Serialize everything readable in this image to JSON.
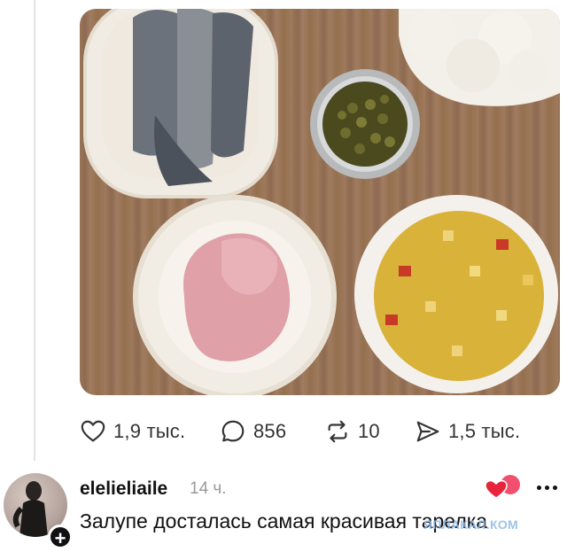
{
  "post": {
    "photo_alt": "photo",
    "stats": {
      "likes": "1,9 тыс.",
      "comments": "856",
      "reposts": "10",
      "shares": "1,5 тыс."
    }
  },
  "comment": {
    "username": "elelieliaile",
    "time": "14 ч.",
    "text": "Залупе досталась самая красивая тарелка"
  },
  "watermark": "ЯПЛАКАЛ.КОМ",
  "icons": {
    "like": "heart-outline-icon",
    "comment": "speech-bubble-icon",
    "repost": "repost-arrows-icon",
    "share": "paper-plane-icon",
    "follow": "plus-icon",
    "reactions": "heart-reactions-icon",
    "more": "more-dots-icon"
  },
  "colors": {
    "accent_red": "#e8243c",
    "reaction_pink": "#f0506e",
    "muted_text": "#9a9a9a",
    "text": "#111111"
  }
}
